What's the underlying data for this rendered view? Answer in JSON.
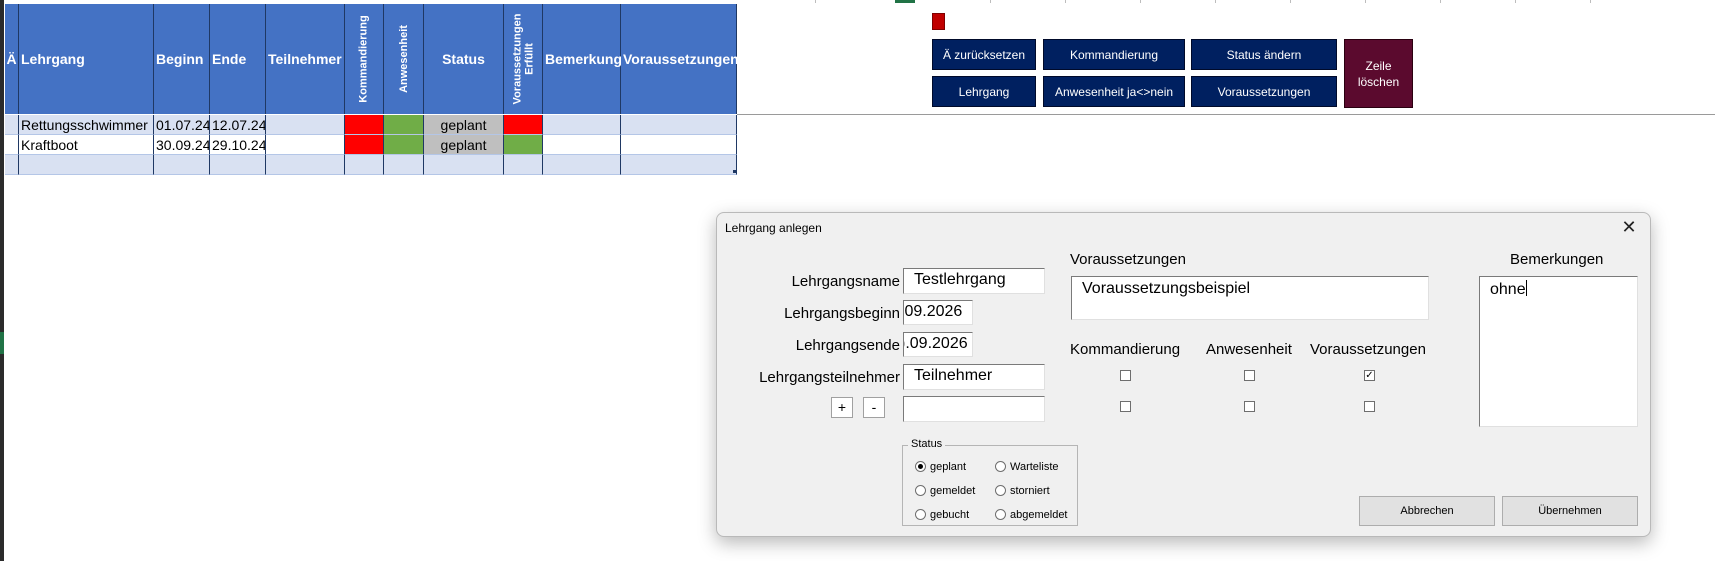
{
  "table": {
    "headers": {
      "ae": "Ä",
      "lehrgang": "Lehrgang",
      "beginn": "Beginn",
      "ende": "Ende",
      "teilnehmer": "Teilnehmer",
      "kommandierung": "Kommandierung",
      "anwesenheit": "Anwesenheit",
      "status": "Status",
      "vor_erfuellt_1": "Voraussetzungen",
      "vor_erfuellt_2": "Erfüllt",
      "bemerkung": "Bemerkung",
      "voraussetzungen": "Voraussetzungen"
    },
    "rows": [
      {
        "lehrgang": "Rettungsschwimmer",
        "beginn": "01.07.24",
        "ende": "12.07.24",
        "teilnehmer": "",
        "status": "geplant",
        "bemerkung": "",
        "voraussetzungen": ""
      },
      {
        "lehrgang": "Kraftboot",
        "beginn": "30.09.24",
        "ende": "29.10.24",
        "teilnehmer": "",
        "status": "geplant",
        "bemerkung": "",
        "voraussetzungen": ""
      }
    ],
    "colors": {
      "header": "#4472c4",
      "band": "#d9e1f2",
      "red": "#ff0000",
      "green": "#70ad47",
      "grey": "#bfbfbf"
    }
  },
  "macro_buttons": {
    "ae_reset": "Ä zurücksetzen",
    "kommandierung": "Kommandierung",
    "status_aendern": "Status ändern",
    "lehrgang": "Lehrgang",
    "anwesenheit": "Anwesenheit ja<>nein",
    "voraussetzungen": "Voraussetzungen",
    "zeile_loeschen": "Zeile\nlöschen",
    "colors": {
      "navy": "#002060",
      "maroon": "#5b0a2e"
    }
  },
  "dialog": {
    "title": "Lehrgang anlegen",
    "close_icon": "close-icon",
    "labels": {
      "name": "Lehrgangsname",
      "beginn": "Lehrgangsbeginn",
      "ende": "Lehrgangsende",
      "teilnehmer": "Lehrgangsteilnehmer"
    },
    "values": {
      "name": "Testlehrgang",
      "beginn": ".09.2026",
      "ende": ").09.2026",
      "teilnehmer": "Teilnehmer",
      "teilnehmer2": ""
    },
    "plus": "+",
    "minus": "-",
    "voraussetzungen_label": "Voraussetzungen",
    "voraussetzungen_value": "Voraussetzungsbeispiel",
    "bemerkungen_label": "Bemerkungen",
    "bemerkungen_value": "ohne",
    "col_kommandierung": "Kommandierung",
    "col_anwesenheit": "Anwesenheit",
    "col_voraussetzungen": "Voraussetzungen",
    "checks": [
      [
        false,
        false,
        true
      ],
      [
        false,
        false,
        false
      ]
    ],
    "status": {
      "title": "Status",
      "options": [
        "geplant",
        "gemeldet",
        "gebucht",
        "Warteliste",
        "storniert",
        "abgemeldet"
      ],
      "selected": "geplant"
    },
    "cancel": "Abbrechen",
    "ok": "Übernehmen"
  }
}
